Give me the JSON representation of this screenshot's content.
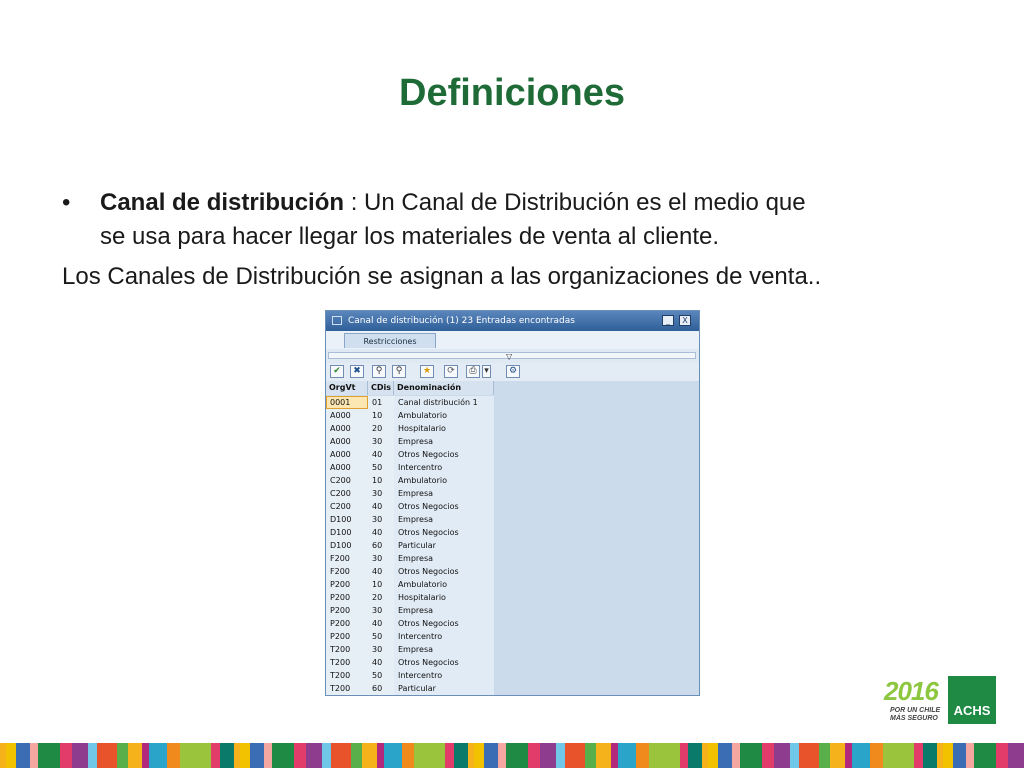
{
  "slide": {
    "title": "Definiciones",
    "bullet_marker": "•",
    "bullet_term": "Canal de distribución",
    "bullet_line1": " : Un Canal de Distribución es el medio que",
    "bullet_line2": "se usa para hacer llegar los materiales de venta al cliente.",
    "line2": "Los Canales de Distribución se asignan a las organizaciones de venta.."
  },
  "window": {
    "title": "Canal de distribución (1)   23 Entradas encontradas",
    "minimize_label": "_",
    "close_label": "X",
    "tab_label": "Restricciones",
    "restrict_arrow": "▽",
    "toolbar_icons": [
      "check-icon",
      "cancel-icon",
      "find-icon",
      "find-next-icon",
      "new-search-icon",
      "print-icon",
      "dropdown-icon",
      "settings-icon"
    ],
    "toolbar_glyphs": [
      "✔",
      "✖",
      "⚲",
      "★",
      "⟳",
      "⎙",
      "▾",
      "⚙"
    ],
    "columns": [
      "OrgVt",
      "CDis",
      "Denominación"
    ],
    "rows": [
      [
        "0001",
        "01",
        "Canal distribución 1"
      ],
      [
        "A000",
        "10",
        "Ambulatorio"
      ],
      [
        "A000",
        "20",
        "Hospitalario"
      ],
      [
        "A000",
        "30",
        "Empresa"
      ],
      [
        "A000",
        "40",
        "Otros Negocios"
      ],
      [
        "A000",
        "50",
        "Intercentro"
      ],
      [
        "C200",
        "10",
        "Ambulatorio"
      ],
      [
        "C200",
        "30",
        "Empresa"
      ],
      [
        "C200",
        "40",
        "Otros Negocios"
      ],
      [
        "D100",
        "30",
        "Empresa"
      ],
      [
        "D100",
        "40",
        "Otros Negocios"
      ],
      [
        "D100",
        "60",
        "Particular"
      ],
      [
        "F200",
        "30",
        "Empresa"
      ],
      [
        "F200",
        "40",
        "Otros Negocios"
      ],
      [
        "P200",
        "10",
        "Ambulatorio"
      ],
      [
        "P200",
        "20",
        "Hospitalario"
      ],
      [
        "P200",
        "30",
        "Empresa"
      ],
      [
        "P200",
        "40",
        "Otros Negocios"
      ],
      [
        "P200",
        "50",
        "Intercentro"
      ],
      [
        "T200",
        "30",
        "Empresa"
      ],
      [
        "T200",
        "40",
        "Otros Negocios"
      ],
      [
        "T200",
        "50",
        "Intercentro"
      ],
      [
        "T200",
        "60",
        "Particular"
      ]
    ]
  },
  "logo": {
    "year": "2016",
    "tagline_1": "POR UN CHILE",
    "tagline_2": "MÁS SEGURO",
    "brand": "ACHS"
  },
  "colors": {
    "title": "#1e6b38",
    "brand_green": "#1e8a44",
    "year_green": "#8dc63f",
    "stripe": [
      "#f6b21a",
      "#f08a1c",
      "#e8532b",
      "#f4a6a0",
      "#e23c6a",
      "#b2287a",
      "#8e3c8e",
      "#f2c100",
      "#9ac43b",
      "#59b04a",
      "#1e8a44",
      "#0a7a6a",
      "#2aa5c9",
      "#71c7e8",
      "#3a6db3",
      "#9ac43b",
      "#f6b21a",
      "#e23c6a"
    ]
  }
}
